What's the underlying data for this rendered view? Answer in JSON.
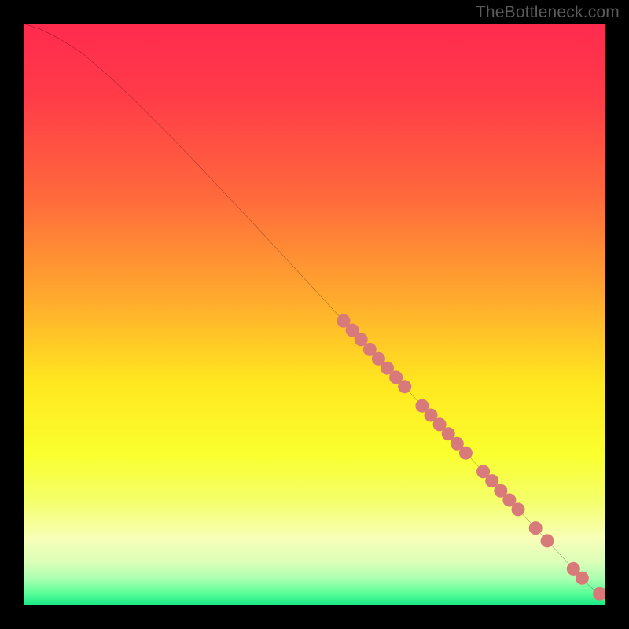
{
  "watermark": "TheBottleneck.com",
  "chart_data": {
    "type": "line",
    "title": "",
    "xlabel": "",
    "ylabel": "",
    "xlim": [
      0,
      100
    ],
    "ylim": [
      0,
      100
    ],
    "grid": false,
    "series": [
      {
        "name": "curve",
        "color": "#000000",
        "x": [
          0,
          3,
          6,
          10,
          15,
          20,
          25,
          30,
          35,
          40,
          45,
          50,
          55,
          60,
          65,
          70,
          75,
          80,
          85,
          90,
          93,
          95,
          97,
          98.5,
          100
        ],
        "y": [
          100,
          99,
          97.5,
          95,
          90.7,
          85.9,
          80.9,
          75.7,
          70.4,
          65.1,
          59.7,
          54.3,
          48.9,
          43.5,
          38.1,
          32.7,
          27.3,
          21.9,
          16.5,
          11.1,
          7.9,
          5.7,
          3.6,
          2.2,
          2.0
        ]
      }
    ],
    "markers": {
      "name": "highlighted-points",
      "color": "#d97a7a",
      "radius_pct": 1.15,
      "points": [
        {
          "x": 55.0,
          "y": 48.9
        },
        {
          "x": 56.5,
          "y": 47.3
        },
        {
          "x": 58.0,
          "y": 45.7
        },
        {
          "x": 59.5,
          "y": 44.0
        },
        {
          "x": 61.0,
          "y": 42.4
        },
        {
          "x": 62.5,
          "y": 40.8
        },
        {
          "x": 64.0,
          "y": 39.2
        },
        {
          "x": 65.5,
          "y": 37.6
        },
        {
          "x": 68.5,
          "y": 34.3
        },
        {
          "x": 70.0,
          "y": 32.7
        },
        {
          "x": 71.5,
          "y": 31.1
        },
        {
          "x": 73.0,
          "y": 29.5
        },
        {
          "x": 74.5,
          "y": 27.8
        },
        {
          "x": 76.0,
          "y": 26.2
        },
        {
          "x": 79.0,
          "y": 23.0
        },
        {
          "x": 80.5,
          "y": 21.4
        },
        {
          "x": 82.0,
          "y": 19.7
        },
        {
          "x": 83.5,
          "y": 18.1
        },
        {
          "x": 85.0,
          "y": 16.5
        },
        {
          "x": 88.0,
          "y": 13.3
        },
        {
          "x": 90.0,
          "y": 11.1
        },
        {
          "x": 94.5,
          "y": 6.3
        },
        {
          "x": 96.0,
          "y": 4.7
        },
        {
          "x": 99.0,
          "y": 2.0
        },
        {
          "x": 100.5,
          "y": 2.0
        }
      ]
    },
    "background_gradient": {
      "stops": [
        {
          "offset": 0.0,
          "color": "#ff2b4e"
        },
        {
          "offset": 0.12,
          "color": "#ff3a49"
        },
        {
          "offset": 0.3,
          "color": "#ff6a3c"
        },
        {
          "offset": 0.48,
          "color": "#ffad2d"
        },
        {
          "offset": 0.62,
          "color": "#ffe81f"
        },
        {
          "offset": 0.74,
          "color": "#faff2e"
        },
        {
          "offset": 0.82,
          "color": "#f4ff6a"
        },
        {
          "offset": 0.885,
          "color": "#f8ffb8"
        },
        {
          "offset": 0.925,
          "color": "#dcffb8"
        },
        {
          "offset": 0.955,
          "color": "#a8ffb0"
        },
        {
          "offset": 0.978,
          "color": "#5eff9a"
        },
        {
          "offset": 1.0,
          "color": "#17e884"
        }
      ]
    }
  }
}
